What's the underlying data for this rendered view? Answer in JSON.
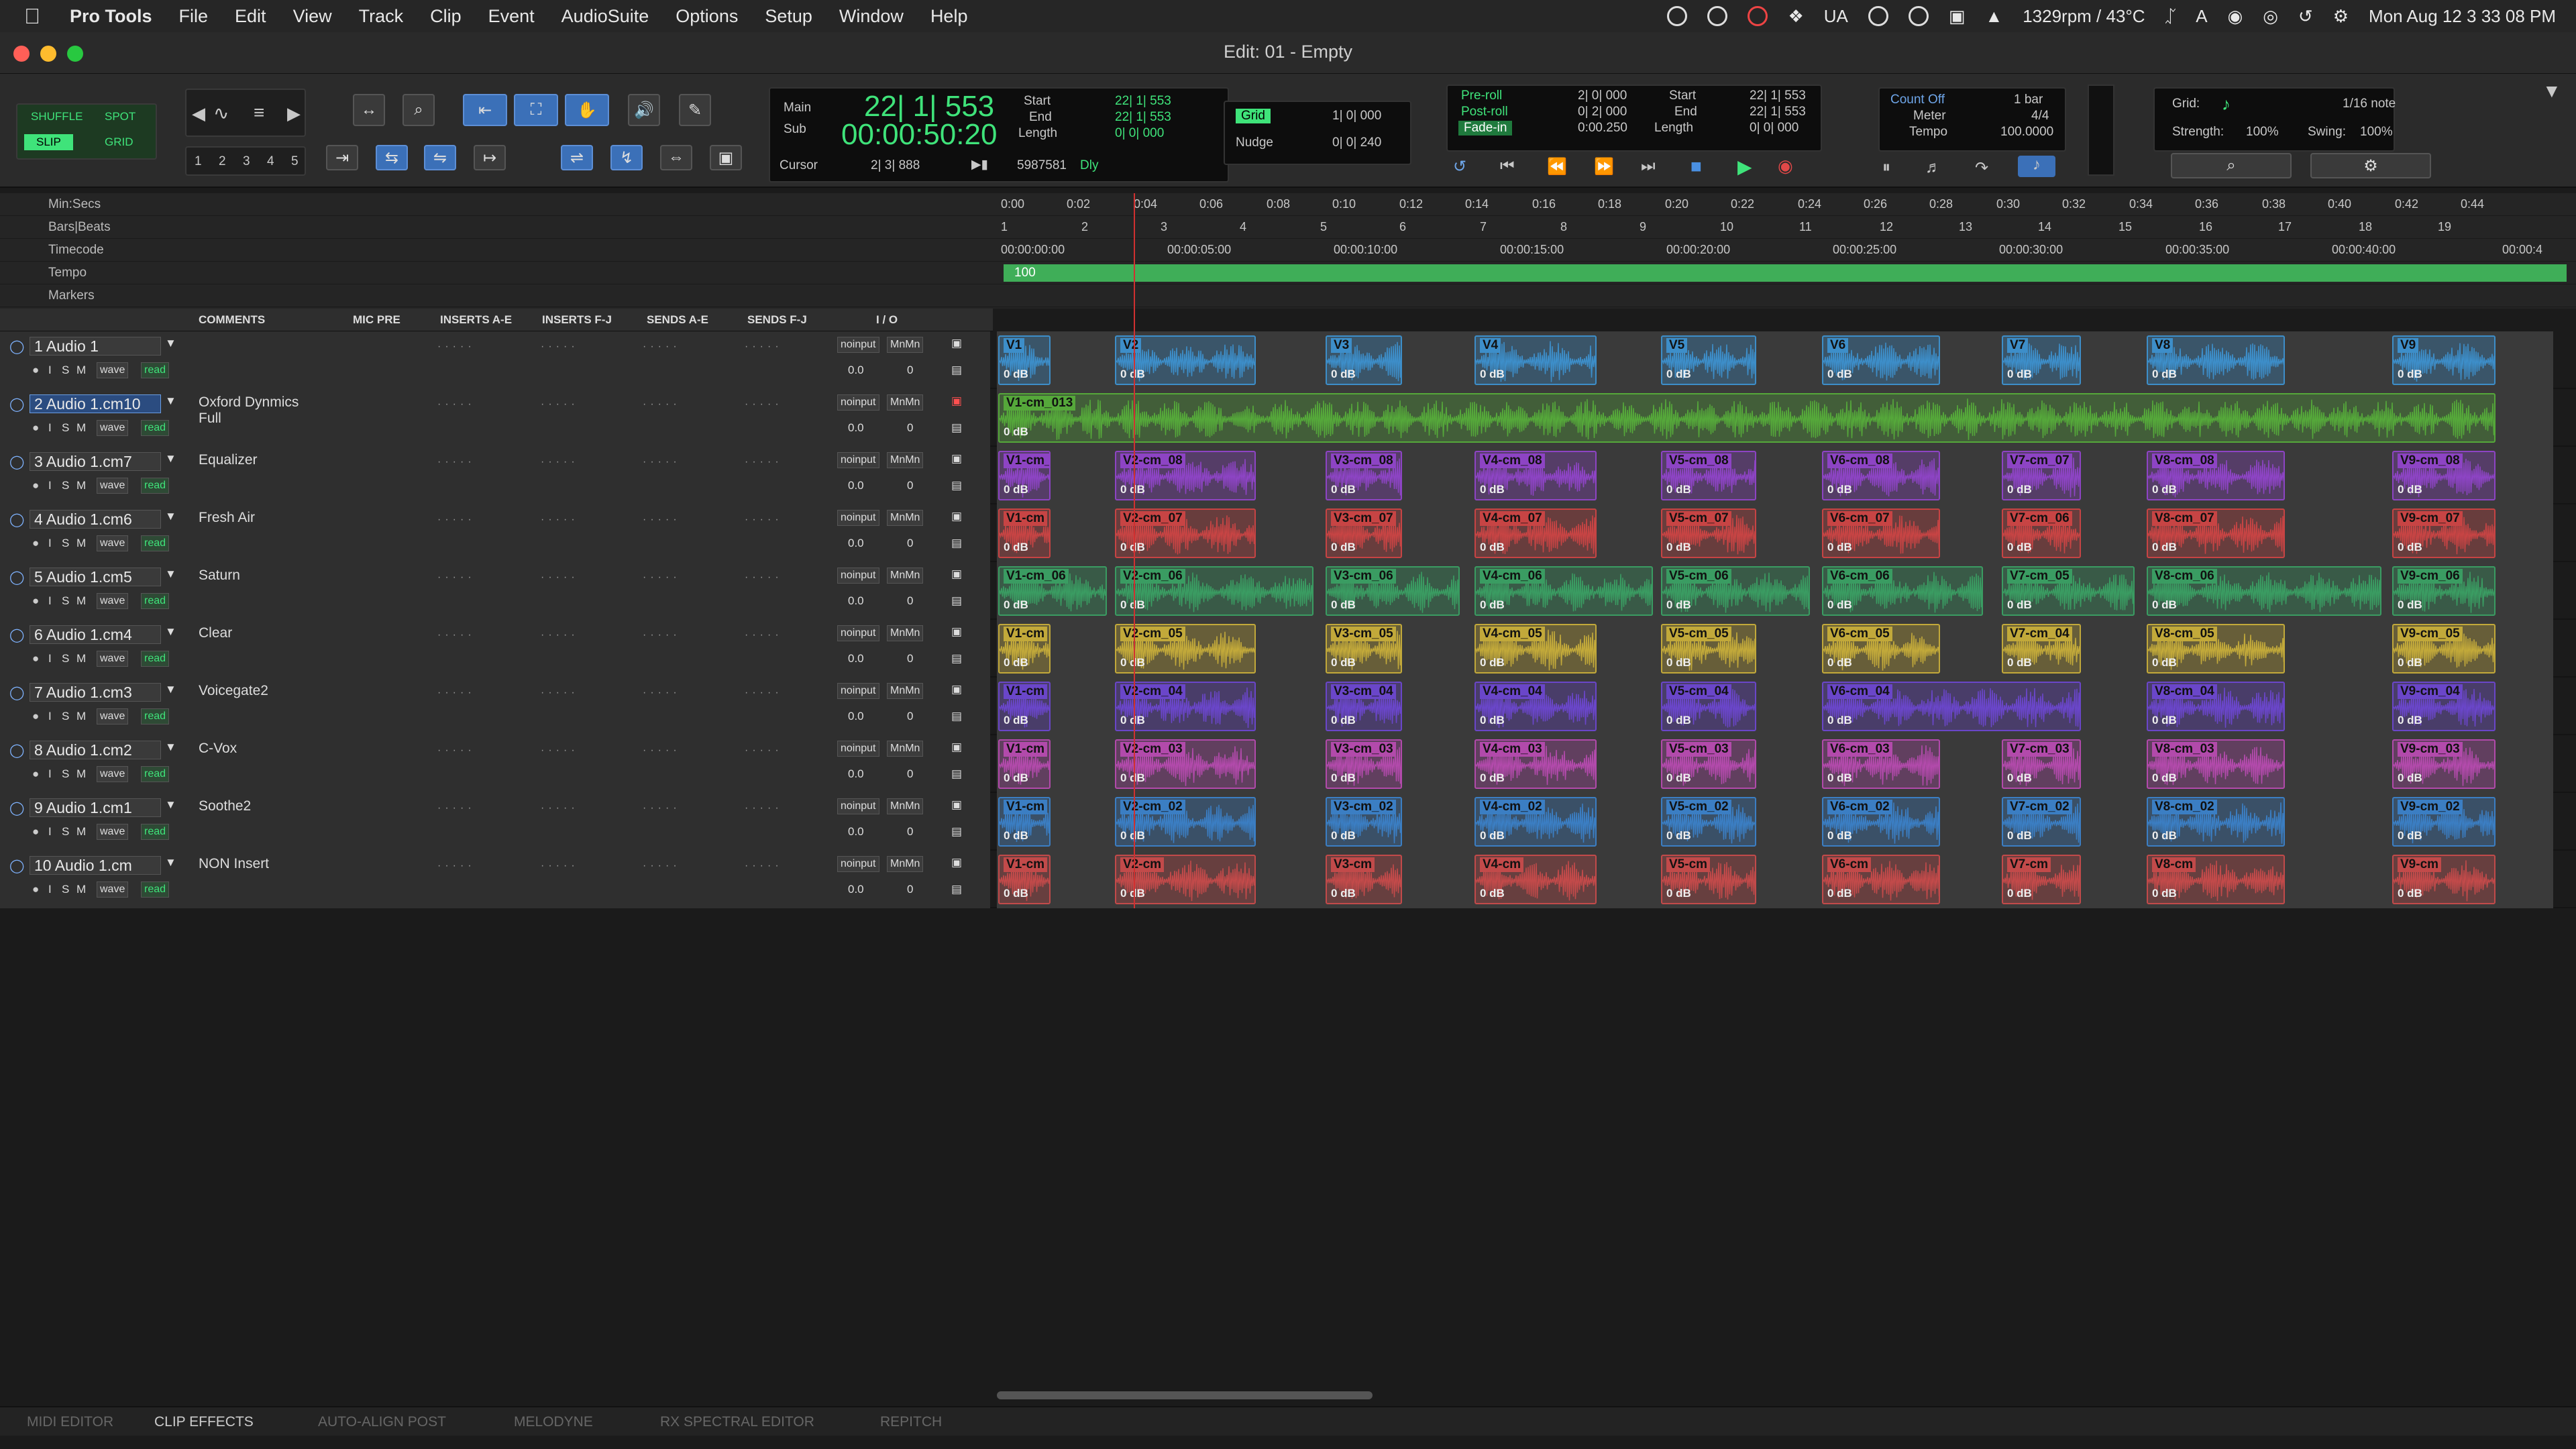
{
  "menubar": {
    "app": "Pro Tools",
    "items": [
      "File",
      "Edit",
      "View",
      "Track",
      "Clip",
      "Event",
      "AudioSuite",
      "Options",
      "Setup",
      "Window",
      "Help"
    ],
    "ua": "UA",
    "fan": "1329rpm / 43°C",
    "datetime": "Mon Aug 12  3 33 08 PM"
  },
  "window": {
    "title": "Edit: 01 - Empty"
  },
  "modes": {
    "shuffle": "SHUFFLE",
    "spot": "SPOT",
    "slip": "SLIP",
    "grid": "GRID"
  },
  "zoom_presets": [
    "1",
    "2",
    "3",
    "4",
    "5"
  ],
  "counter": {
    "main_label": "Main",
    "sub_label": "Sub",
    "main": "22| 1| 553",
    "sub": "00:00:50:20",
    "start_label": "Start",
    "end_label": "End",
    "length_label": "Length",
    "start": "22| 1| 553",
    "end": "22| 1| 553",
    "length": "0| 0| 000",
    "cursor_label": "Cursor",
    "cursor": "2| 3| 888",
    "samples": "5987581",
    "dly": "Dly"
  },
  "grid": {
    "label": "Grid",
    "value": "1| 0| 000",
    "nudge_label": "Nudge",
    "nudge": "0| 0| 240"
  },
  "preroll": {
    "pre_label": "Pre-roll",
    "post_label": "Post-roll",
    "fade_label": "Fade-in",
    "pre": "2| 0| 000",
    "post": "0| 2| 000",
    "fade": "0:00.250",
    "start_label": "Start",
    "end_label": "End",
    "length_label": "Length",
    "start": "22| 1| 553",
    "end": "22| 1| 553",
    "length": "0| 0| 000"
  },
  "countoff": {
    "count_off": "Count Off",
    "count_val": "1 bar",
    "meter_label": "Meter",
    "meter": "4/4",
    "tempo_label": "Tempo",
    "tempo": "100.0000"
  },
  "gridpanel": {
    "grid_label": "Grid:",
    "note": "1/16 note",
    "strength_label": "Strength:",
    "strength": "100%",
    "swing_label": "Swing:",
    "swing": "100%"
  },
  "rulers": {
    "names": [
      "Min:Secs",
      "Bars|Beats",
      "Timecode",
      "Tempo",
      "Markers"
    ],
    "minsecs": [
      "0:00",
      "0:02",
      "0:04",
      "0:06",
      "0:08",
      "0:10",
      "0:12",
      "0:14",
      "0:16",
      "0:18",
      "0:20",
      "0:22",
      "0:24",
      "0:26",
      "0:28",
      "0:30",
      "0:32",
      "0:34",
      "0:36",
      "0:38",
      "0:40",
      "0:42",
      "0:44"
    ],
    "bars": [
      "1",
      "2",
      "3",
      "4",
      "5",
      "6",
      "7",
      "8",
      "9",
      "10",
      "11",
      "12",
      "13",
      "14",
      "15",
      "16",
      "17",
      "18",
      "19"
    ],
    "timecode": [
      "00:00:00:00",
      "00:00:05:00",
      "00:00:10:00",
      "00:00:15:00",
      "00:00:20:00",
      "00:00:25:00",
      "00:00:30:00",
      "00:00:35:00",
      "00:00:40:00",
      "00:00:4"
    ],
    "tempo": "100"
  },
  "columns": {
    "comments": "COMMENTS",
    "mic_pre": "MIC PRE",
    "inserts_ae": "INSERTS A-E",
    "inserts_fj": "INSERTS F-J",
    "sends_ae": "SENDS A-E",
    "sends_fj": "SENDS F-J",
    "io": "I / O"
  },
  "trackui": {
    "i": "I",
    "s": "S",
    "m": "M",
    "view": "wave",
    "auto": "read",
    "input": "noinput",
    "output": "MnMn",
    "vol": "0.0",
    "pan": "0"
  },
  "tracks": [
    {
      "name": "1  Audio 1",
      "comment": "",
      "color": "#3d8ec9",
      "clips": [
        "V1",
        "V2",
        "V3",
        "V4",
        "V5",
        "V6",
        "V7",
        "V8",
        "V9"
      ]
    },
    {
      "name": "2  Audio 1.cm10",
      "comment": "Oxford Dynmics\nFull",
      "color": "#55a83a",
      "clips": [
        "V1-cm_013"
      ]
    },
    {
      "name": "3  Audio 1.cm7",
      "comment": "Equalizer",
      "color": "#8d44c4",
      "clips": [
        "V1-cm_",
        "V2-cm_08",
        "V3-cm_08",
        "V4-cm_08",
        "V5-cm_08",
        "V6-cm_08",
        "V7-cm_07",
        "V8-cm_08",
        "V9-cm_08"
      ]
    },
    {
      "name": "4  Audio 1.cm6",
      "comment": "Fresh Air",
      "color": "#c74444",
      "clips": [
        "V1-cm",
        "V2-cm_07",
        "V3-cm_07",
        "V4-cm_07",
        "V5-cm_07",
        "V6-cm_07",
        "V7-cm_06",
        "V8-cm_07",
        "V9-cm_07"
      ]
    },
    {
      "name": "5  Audio 1.cm5",
      "comment": "Saturn",
      "color": "#3a9c62",
      "clips": [
        "V1-cm_06",
        "V2-cm_06",
        "V3-cm_06",
        "V4-cm_06",
        "V5-cm_06",
        "V6-cm_06",
        "V7-cm_05",
        "V8-cm_06",
        "V9-cm_06"
      ]
    },
    {
      "name": "6  Audio 1.cm4",
      "comment": "Clear",
      "color": "#c2a93a",
      "clips": [
        "V1-cm",
        "V2-cm_05",
        "V3-cm_05",
        "V4-cm_05",
        "V5-cm_05",
        "V6-cm_05",
        "V7-cm_04",
        "V8-cm_05",
        "V9-cm_05"
      ]
    },
    {
      "name": "7  Audio 1.cm3",
      "comment": "Voicegate2",
      "color": "#6a46c9",
      "clips": [
        "V1-cm",
        "V2-cm_04",
        "V3-cm_04",
        "V4-cm_04",
        "V5-cm_04",
        "V6-cm_04",
        "V8-cm_04",
        "V9-cm_04"
      ]
    },
    {
      "name": "8  Audio 1.cm2",
      "comment": "C-Vox",
      "color": "#b24aab",
      "clips": [
        "V1-cm",
        "V2-cm_03",
        "V3-cm_03",
        "V4-cm_03",
        "V5-cm_03",
        "V6-cm_03",
        "V7-cm_03",
        "V8-cm_03",
        "V9-cm_03"
      ]
    },
    {
      "name": "9  Audio 1.cm1",
      "comment": "Soothe2",
      "color": "#3b7ec3",
      "clips": [
        "V1-cm",
        "V2-cm_02",
        "V3-cm_02",
        "V4-cm_02",
        "V5-cm_02",
        "V6-cm_02",
        "V7-cm_02",
        "V8-cm_02",
        "V9-cm_02"
      ]
    },
    {
      "name": "10  Audio 1.cm",
      "comment": "NON Insert",
      "color": "#c24a4a",
      "clips": [
        "V1-cm",
        "V2-cm",
        "V3-cm",
        "V4-cm",
        "V5-cm",
        "V6-cm",
        "V7-cm",
        "V8-cm",
        "V9-cm"
      ]
    }
  ],
  "clip_gain": "0 dB",
  "bottom_tabs": [
    "MIDI EDITOR",
    "CLIP EFFECTS",
    "AUTO-ALIGN POST",
    "MELODYNE",
    "RX SPECTRAL EDITOR",
    "REPITCH"
  ]
}
